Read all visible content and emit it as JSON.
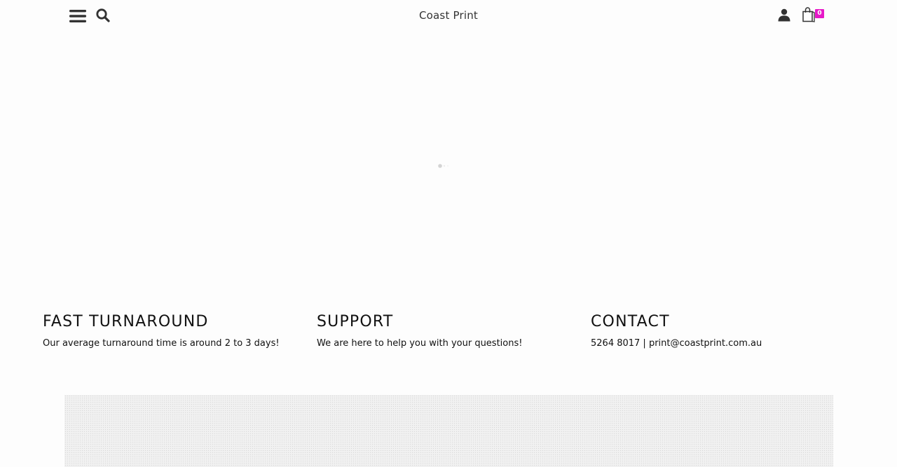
{
  "header": {
    "brand": "Coast Print",
    "cart_count": "0",
    "icons": {
      "menu": "hamburger-menu-icon",
      "search": "search-icon",
      "account": "user-icon",
      "cart": "shopping-bag-icon"
    }
  },
  "features": [
    {
      "title": "FAST TURNAROUND",
      "text": "Our average turnaround time is around 2 to 3 days!"
    },
    {
      "title": "SUPPORT",
      "text": "We are here to help you with your questions!"
    },
    {
      "title": "CONTACT",
      "text": "5264 8017 | print@coastprint.com.au"
    }
  ],
  "colors": {
    "background": "#fdfdfd",
    "badge": "#e619c8",
    "text": "#111111"
  }
}
